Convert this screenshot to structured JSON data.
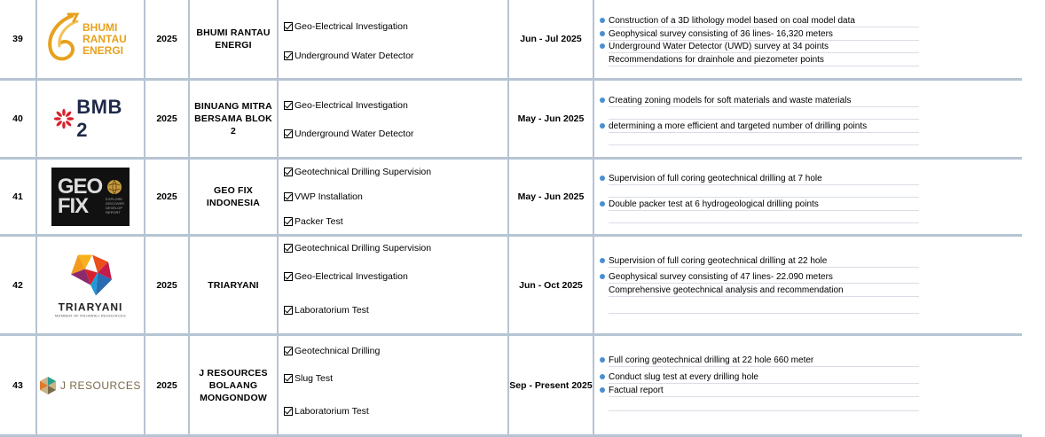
{
  "rows": [
    {
      "no": "39",
      "logo": {
        "name": "BHUMI RANTAU ENERGI",
        "line1": "BHUMI",
        "line2": "RANTAU",
        "line3": "ENERGI",
        "color": "#e7a11d"
      },
      "year": "2025",
      "client": "BHUMI RANTAU ENERGI",
      "scope": [
        "Geo-Electrical Investigation",
        "Underground Water Detector"
      ],
      "period": "Jun - Jul 2025",
      "desc": [
        {
          "text": "Construction of a 3D lithology model based on coal model data",
          "bullet": true
        },
        {
          "text": "Geophysical survey consisting of 36 lines- 16,320 meters",
          "bullet": true
        },
        {
          "text": "Underground Water Detector (UWD) survey at 34 points",
          "bullet": true
        },
        {
          "text": "Recommendations for drainhole and piezometer points",
          "bullet": false
        }
      ]
    },
    {
      "no": "40",
      "logo": {
        "name": "BMB 2",
        "text": "BMB 2",
        "color": "#d7202a",
        "textcolor": "#1f2a4a"
      },
      "year": "2025",
      "client": "BINUANG MITRA BERSAMA BLOK 2",
      "scope": [
        "Geo-Electrical Investigation",
        "Underground Water Detector"
      ],
      "period": "May - Jun 2025",
      "desc": [
        {
          "text": "Creating zoning models for soft materials and waste materials",
          "bullet": true
        },
        {
          "text": "",
          "bullet": false
        },
        {
          "text": "determining a more efficient and targeted number of drilling points",
          "bullet": true
        },
        {
          "text": "",
          "bullet": false
        }
      ]
    },
    {
      "no": "41",
      "logo": {
        "name": "GEO FIX",
        "line1": "GEO",
        "line2": "FIX",
        "tag": "EXPLORE DISCOVER DEVELOP REPORT"
      },
      "year": "2025",
      "client": "GEO FIX INDONESIA",
      "scope": [
        "Geotechnical Drilling Supervision",
        "VWP Installation",
        "Packer Test"
      ],
      "period": "May - Jun 2025",
      "desc": [
        {
          "text": "Supervision of full coring geotechnical drilling at 7 hole",
          "bullet": true
        },
        {
          "text": "",
          "bullet": false
        },
        {
          "text": "Double packer test at 6 hydrogeological drilling points",
          "bullet": true
        },
        {
          "text": "",
          "bullet": false
        }
      ]
    },
    {
      "no": "42",
      "logo": {
        "name": "TRIARYANI",
        "text": "TRIARYANI",
        "tag": "MEMBER OF RAJAWALI RESOURCES"
      },
      "year": "2025",
      "client": "TRIARYANI",
      "scope": [
        "Geotechnical Drilling Supervision",
        "Geo-Electrical Investigation",
        "Laboratorium Test"
      ],
      "period": "Jun - Oct 2025",
      "desc": [
        {
          "text": "Supervision of full coring geotechnical drilling at 22 hole",
          "bullet": true
        },
        {
          "text": "Geophysical survey consisting of 47 lines- 22.090 meters",
          "bullet": true
        },
        {
          "text": "Comprehensive geotechnical analysis and recommendation",
          "bullet": false
        },
        {
          "text": "",
          "bullet": false
        }
      ]
    },
    {
      "no": "43",
      "logo": {
        "name": "J RESOURCES",
        "text": "J RESOURCES",
        "color": "#8a7a5a"
      },
      "year": "2025",
      "client": "J RESOURCES BOLAANG MONGONDOW",
      "scope": [
        "Geotechnical Drilling",
        "Slug Test",
        "Laboratorium Test"
      ],
      "period": "Sep - Present 2025",
      "desc": [
        {
          "text": "Full coring geotechnical drilling at 22 hole 660 meter",
          "bullet": true
        },
        {
          "text": "Conduct slug test at every drilling hole",
          "bullet": true
        },
        {
          "text": "Factual report",
          "bullet": true
        },
        {
          "text": "",
          "bullet": false
        }
      ]
    }
  ]
}
